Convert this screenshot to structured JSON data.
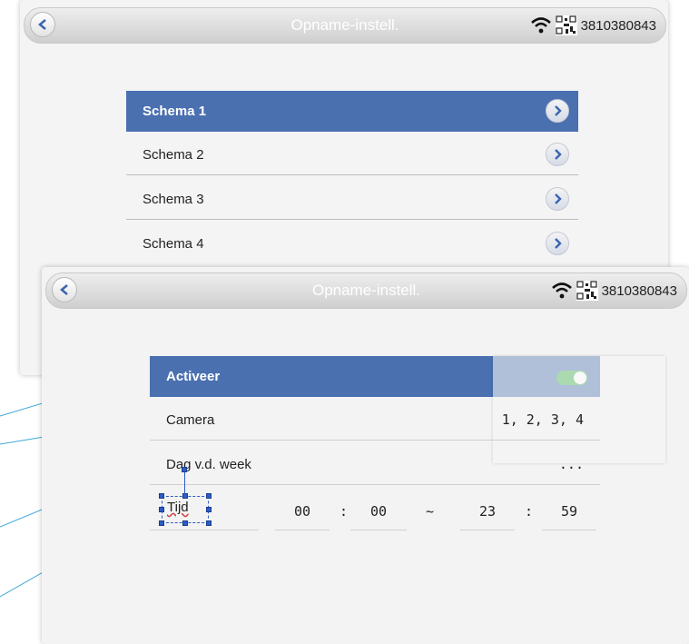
{
  "back_panel": {
    "title": "Opname-instell.",
    "device_id": "3810380843",
    "menu": [
      {
        "label": "Schema 1",
        "active": true
      },
      {
        "label": "Schema 2",
        "active": false
      },
      {
        "label": "Schema 3",
        "active": false
      },
      {
        "label": "Schema 4",
        "active": false
      }
    ]
  },
  "front_panel": {
    "title": "Opname-instell.",
    "device_id": "3810380843",
    "activate_label": "Activeer",
    "activate_on": true,
    "camera_label": "Camera",
    "camera_value": "1, 2, 3, 4",
    "weekday_label": "Dag v.d. week",
    "weekday_value": "...",
    "time_label": "Tijd",
    "start_hour": "00",
    "start_minute": "00",
    "range_sep": "~",
    "end_hour": "23",
    "end_minute": "59",
    "colon": ":"
  },
  "colors": {
    "accent": "#4a70b0",
    "toggle_on": "#3cb24a",
    "callout_line": "#3fa9d6"
  },
  "icons": [
    "back-arrow-icon",
    "wifi-icon",
    "qr-code-icon",
    "chevron-right-icon",
    "toggle-switch"
  ]
}
